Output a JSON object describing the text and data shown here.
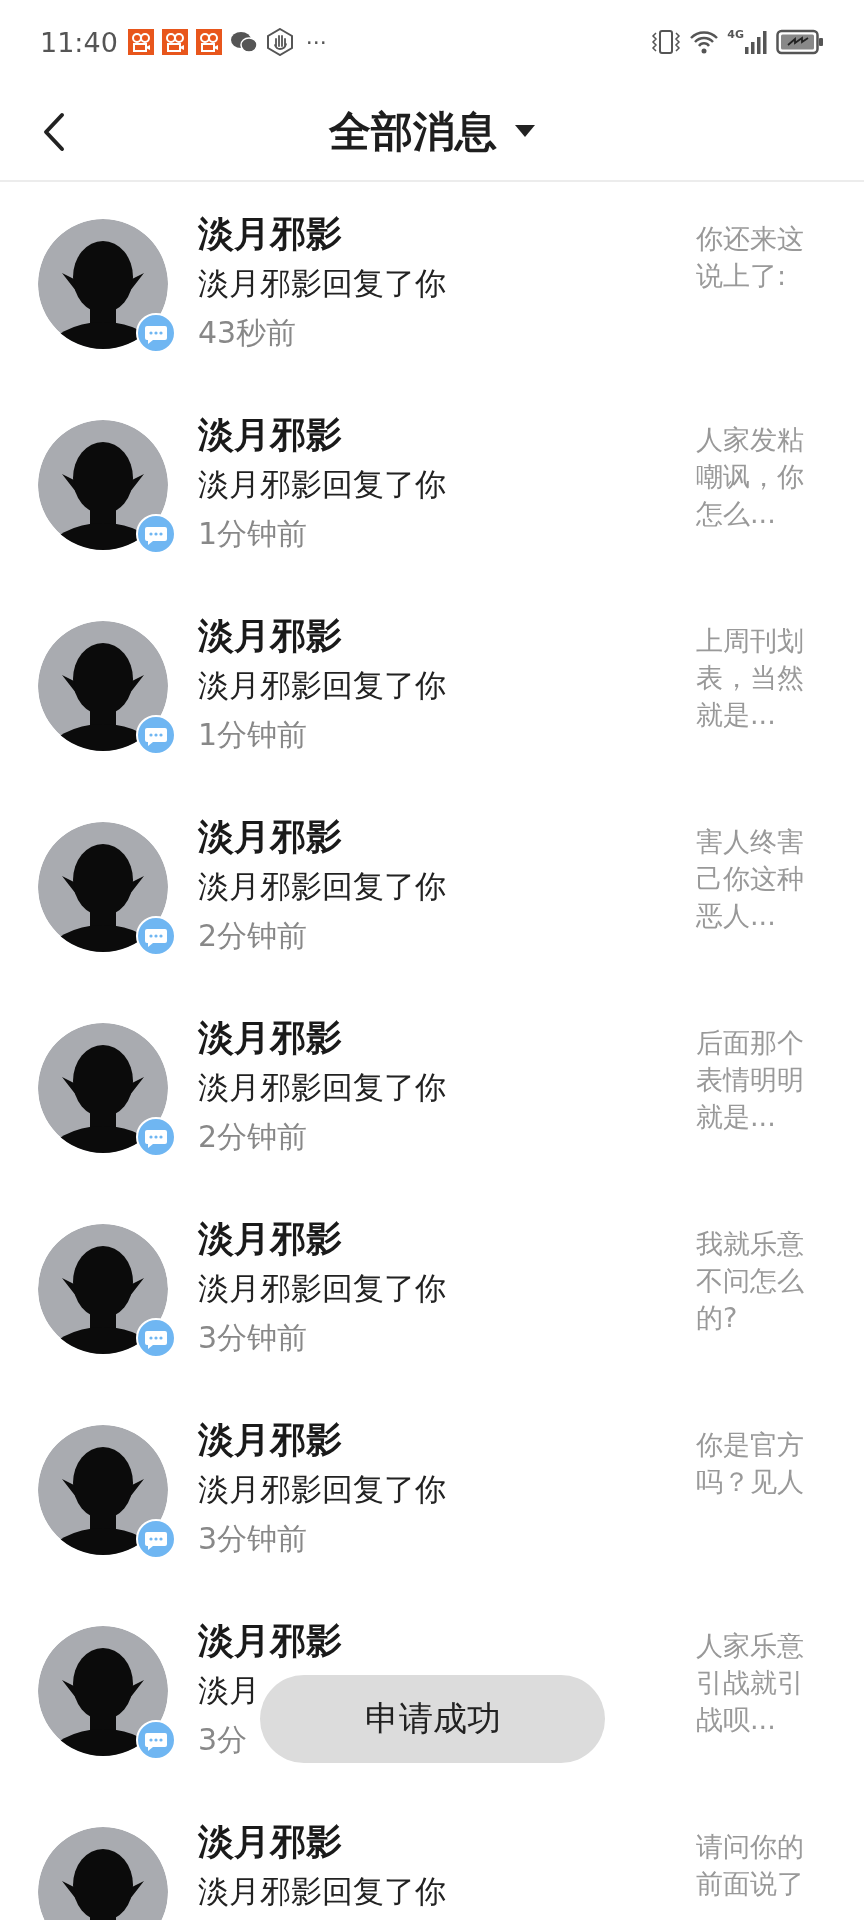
{
  "status_bar": {
    "time": "11:40",
    "notifications": [
      {
        "kind": "app"
      },
      {
        "kind": "app"
      },
      {
        "kind": "app"
      },
      {
        "kind": "chat"
      },
      {
        "kind": "hand"
      }
    ],
    "more": "···",
    "network": "4G"
  },
  "header": {
    "title": "全部消息"
  },
  "messages": [
    {
      "name": "淡月邪影",
      "action": "淡月邪影回复了你",
      "time": "43秒前",
      "preview": "你还来这说上了:"
    },
    {
      "name": "淡月邪影",
      "action": "淡月邪影回复了你",
      "time": "1分钟前",
      "preview": "人家发粘嘲讽，你怎么..."
    },
    {
      "name": "淡月邪影",
      "action": "淡月邪影回复了你",
      "time": "1分钟前",
      "preview": "上周刊划表，当然就是..."
    },
    {
      "name": "淡月邪影",
      "action": "淡月邪影回复了你",
      "time": "2分钟前",
      "preview": "害人终害己你这种恶人..."
    },
    {
      "name": "淡月邪影",
      "action": "淡月邪影回复了你",
      "time": "2分钟前",
      "preview": "后面那个表情明明就是..."
    },
    {
      "name": "淡月邪影",
      "action": "淡月邪影回复了你",
      "time": "3分钟前",
      "preview": "我就乐意不问怎么的?"
    },
    {
      "name": "淡月邪影",
      "action": "淡月邪影回复了你",
      "time": "3分钟前",
      "preview": "你是官方吗？见人"
    },
    {
      "name": "淡月邪影",
      "action": "淡月",
      "time": "3分",
      "preview": "人家乐意引战就引战呗..."
    },
    {
      "name": "淡月邪影",
      "action": "淡月邪影回复了你",
      "preview": "请问你的前面说了"
    }
  ],
  "toast": "申请成功"
}
